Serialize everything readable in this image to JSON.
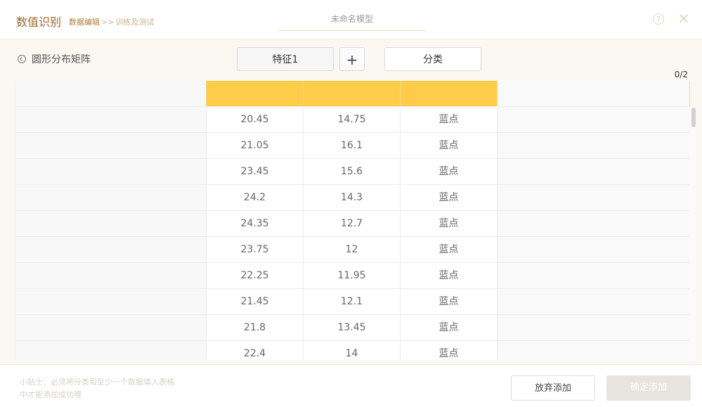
{
  "header": {
    "app_title": "数值识别",
    "breadcrumb_current": "数据编辑",
    "breadcrumb_sep": ">>",
    "breadcrumb_next": "训练及测试",
    "model_name": "未命名模型",
    "help_icon": "?",
    "close_icon": "×"
  },
  "toolbar": {
    "back_label": "圆形分布矩阵",
    "feature_label": "特征1",
    "add_label": "+",
    "category_label": "分类",
    "counter": "0/2"
  },
  "table": {
    "headers": [
      "",
      "",
      "",
      "",
      ""
    ],
    "rows": [
      [
        "",
        "20.45",
        "14.75",
        "蓝点",
        ""
      ],
      [
        "",
        "21.05",
        "16.1",
        "蓝点",
        ""
      ],
      [
        "",
        "23.45",
        "15.6",
        "蓝点",
        ""
      ],
      [
        "",
        "24.2",
        "14.3",
        "蓝点",
        ""
      ],
      [
        "",
        "24.35",
        "12.7",
        "蓝点",
        ""
      ],
      [
        "",
        "23.75",
        "12",
        "蓝点",
        ""
      ],
      [
        "",
        "22.25",
        "11.95",
        "蓝点",
        ""
      ],
      [
        "",
        "21.45",
        "12.1",
        "蓝点",
        ""
      ],
      [
        "",
        "21.8",
        "13.45",
        "蓝点",
        ""
      ],
      [
        "",
        "22.4",
        "14",
        "蓝点",
        ""
      ]
    ]
  },
  "footer": {
    "tip_line1": "小贴士：必须将分类和至少一个数据填入表格",
    "tip_line2": "中才能添加成功哦",
    "discard_label": "放弃添加",
    "confirm_label": "确定添加"
  },
  "colors": {
    "header_row": "#fecc48",
    "accent": "#9b6a2d",
    "confirm_disabled": "#e8e4df"
  }
}
